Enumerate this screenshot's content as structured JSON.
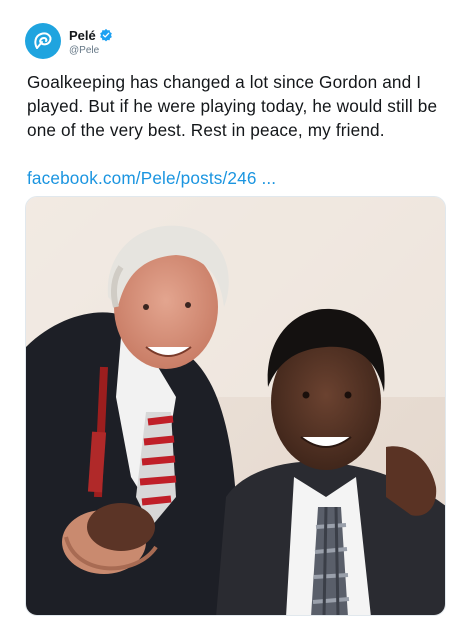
{
  "tweet": {
    "author": {
      "display_name": "Pelé",
      "handle": "@Pele",
      "verified": true,
      "avatar_icon": "profile-avatar-logo",
      "avatar_color": "#1fa4df"
    },
    "text": "Goalkeeping has changed a lot since Gordon and I played. But if he were playing today, he would still be one of the very best. Rest in peace, my friend.",
    "link_text": "facebook.com/Pele/posts/246 ...",
    "link_color": "#1b95e0",
    "media": {
      "type": "photo"
    }
  }
}
